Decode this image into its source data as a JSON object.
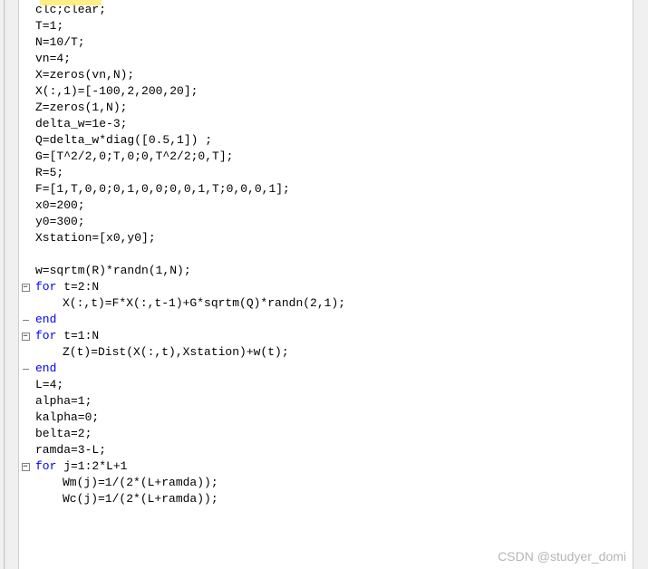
{
  "editor": {
    "lines": [
      {
        "indent": 1,
        "tokens": [
          {
            "t": "clc;clear;",
            "k": false
          }
        ],
        "fold": null
      },
      {
        "indent": 1,
        "tokens": [
          {
            "t": "T=1;",
            "k": false
          }
        ],
        "fold": null
      },
      {
        "indent": 1,
        "tokens": [
          {
            "t": "N=10/T;",
            "k": false
          }
        ],
        "fold": null
      },
      {
        "indent": 1,
        "tokens": [
          {
            "t": "vn=4;",
            "k": false
          }
        ],
        "fold": null
      },
      {
        "indent": 1,
        "tokens": [
          {
            "t": "X=zeros(vn,N);",
            "k": false
          }
        ],
        "fold": null
      },
      {
        "indent": 1,
        "tokens": [
          {
            "t": "X(:,1)=[-100,2,200,20];",
            "k": false
          }
        ],
        "fold": null
      },
      {
        "indent": 1,
        "tokens": [
          {
            "t": "Z=zeros(1,N);",
            "k": false
          }
        ],
        "fold": null
      },
      {
        "indent": 1,
        "tokens": [
          {
            "t": "delta_w=1e-3;",
            "k": false
          }
        ],
        "fold": null
      },
      {
        "indent": 1,
        "tokens": [
          {
            "t": "Q=delta_w*diag([0.5,1]) ;",
            "k": false
          }
        ],
        "fold": null
      },
      {
        "indent": 1,
        "tokens": [
          {
            "t": "G=[T^2/2,0;T,0;0,T^2/2;0,T];",
            "k": false
          }
        ],
        "fold": null
      },
      {
        "indent": 1,
        "tokens": [
          {
            "t": "R=5;",
            "k": false
          }
        ],
        "fold": null
      },
      {
        "indent": 1,
        "tokens": [
          {
            "t": "F=[1,T,0,0;0,1,0,0;0,0,1,T;0,0,0,1];",
            "k": false
          }
        ],
        "fold": null
      },
      {
        "indent": 1,
        "tokens": [
          {
            "t": "x0=200;",
            "k": false
          }
        ],
        "fold": null
      },
      {
        "indent": 1,
        "tokens": [
          {
            "t": "y0=300;",
            "k": false
          }
        ],
        "fold": null
      },
      {
        "indent": 1,
        "tokens": [
          {
            "t": "Xstation=[x0,y0];",
            "k": false
          }
        ],
        "fold": null
      },
      {
        "indent": 1,
        "tokens": [
          {
            "t": "",
            "k": false
          }
        ],
        "fold": null
      },
      {
        "indent": 1,
        "tokens": [
          {
            "t": "w=sqrtm(R)*randn(1,N);",
            "k": false
          }
        ],
        "fold": null
      },
      {
        "indent": 1,
        "tokens": [
          {
            "t": "for",
            "k": true
          },
          {
            "t": " t=2:N",
            "k": false
          }
        ],
        "fold": "minus"
      },
      {
        "indent": 2,
        "tokens": [
          {
            "t": "X(:,t)=F*X(:,t-1)+G*sqrtm(Q)*randn(2,1);",
            "k": false
          }
        ],
        "fold": null
      },
      {
        "indent": 1,
        "tokens": [
          {
            "t": "end",
            "k": true
          }
        ],
        "fold": "end"
      },
      {
        "indent": 1,
        "tokens": [
          {
            "t": "for",
            "k": true
          },
          {
            "t": " t=1:N",
            "k": false
          }
        ],
        "fold": "minus"
      },
      {
        "indent": 2,
        "tokens": [
          {
            "t": "Z(t)=Dist(X(:,t),Xstation)+w(t);",
            "k": false
          }
        ],
        "fold": null
      },
      {
        "indent": 1,
        "tokens": [
          {
            "t": "end",
            "k": true
          }
        ],
        "fold": "end"
      },
      {
        "indent": 1,
        "tokens": [
          {
            "t": "L=4;",
            "k": false
          }
        ],
        "fold": null
      },
      {
        "indent": 1,
        "tokens": [
          {
            "t": "alpha=1;",
            "k": false
          }
        ],
        "fold": null
      },
      {
        "indent": 1,
        "tokens": [
          {
            "t": "kalpha=0;",
            "k": false
          }
        ],
        "fold": null
      },
      {
        "indent": 1,
        "tokens": [
          {
            "t": "belta=2;",
            "k": false
          }
        ],
        "fold": null
      },
      {
        "indent": 1,
        "tokens": [
          {
            "t": "ramda=3-L;",
            "k": false
          }
        ],
        "fold": null
      },
      {
        "indent": 1,
        "tokens": [
          {
            "t": "for",
            "k": true
          },
          {
            "t": " j=1:2*L+1",
            "k": false
          }
        ],
        "fold": "minus"
      },
      {
        "indent": 2,
        "tokens": [
          {
            "t": "Wm(j)=1/(2*(L+ramda));",
            "k": false
          }
        ],
        "fold": null
      },
      {
        "indent": 2,
        "tokens": [
          {
            "t": "Wc(j)=1/(2*(L+ramda));",
            "k": false
          }
        ],
        "fold": null
      }
    ]
  },
  "watermark": "CSDN @studyer_domi"
}
